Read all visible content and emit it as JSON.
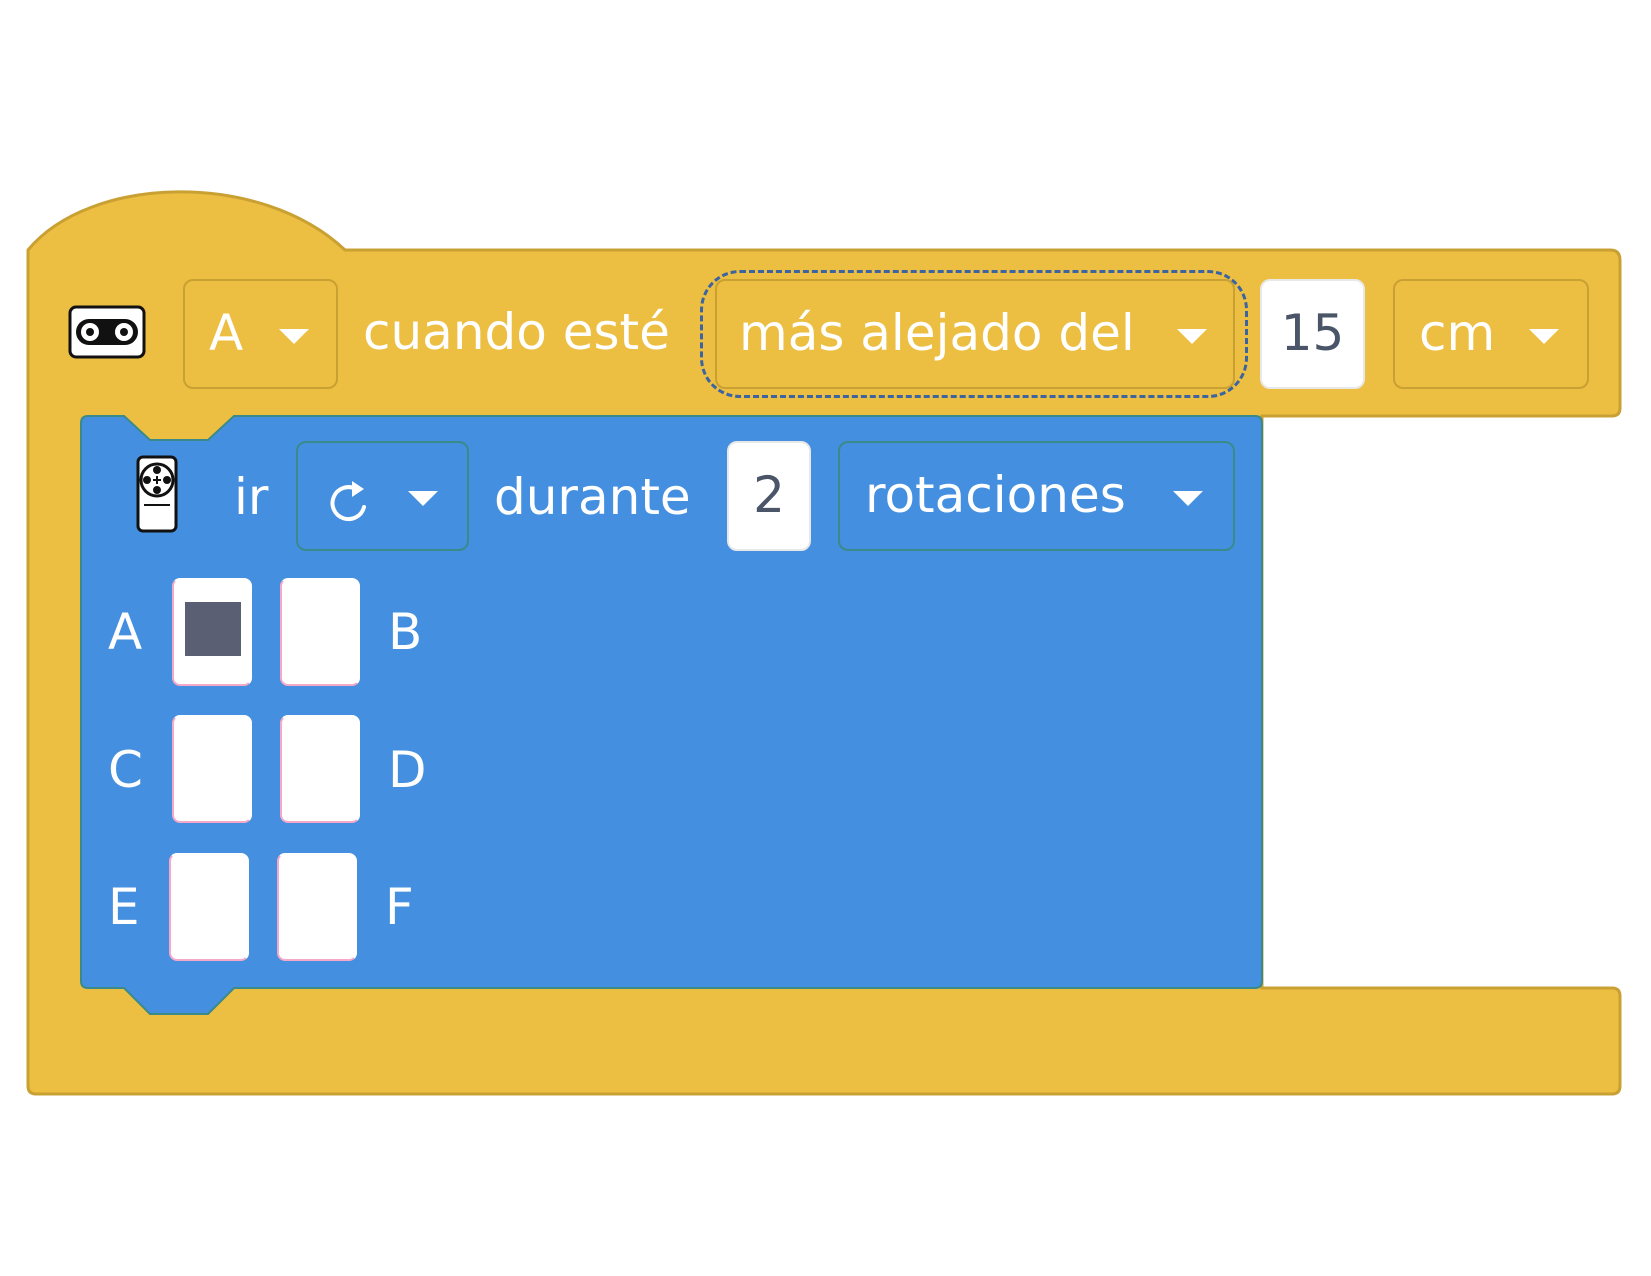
{
  "colors": {
    "hat_block": "#ecbe41",
    "hat_block_border": "#c9a032",
    "motor_block": "#448fdf",
    "motor_block_border": "#3a8a8a",
    "highlight_dash": "#3c64a0",
    "port_selected": "#5a5f73"
  },
  "hat_block": {
    "sensor_icon": "distance-sensor-icon",
    "port_value": "A",
    "text_when": "cuando esté",
    "comparison_value": "más alejado del",
    "distance_value": "15",
    "unit_value": "cm"
  },
  "motor_block": {
    "motor_icon": "motor-icon",
    "text_go": "ir",
    "direction_icon": "clockwise-rotate-icon",
    "text_for": "durante",
    "amount_value": "2",
    "unit_value": "rotaciones",
    "ports": [
      {
        "label": "A",
        "selected": true
      },
      {
        "label": "B",
        "selected": false
      },
      {
        "label": "C",
        "selected": false
      },
      {
        "label": "D",
        "selected": false
      },
      {
        "label": "E",
        "selected": false
      },
      {
        "label": "F",
        "selected": false
      }
    ]
  }
}
